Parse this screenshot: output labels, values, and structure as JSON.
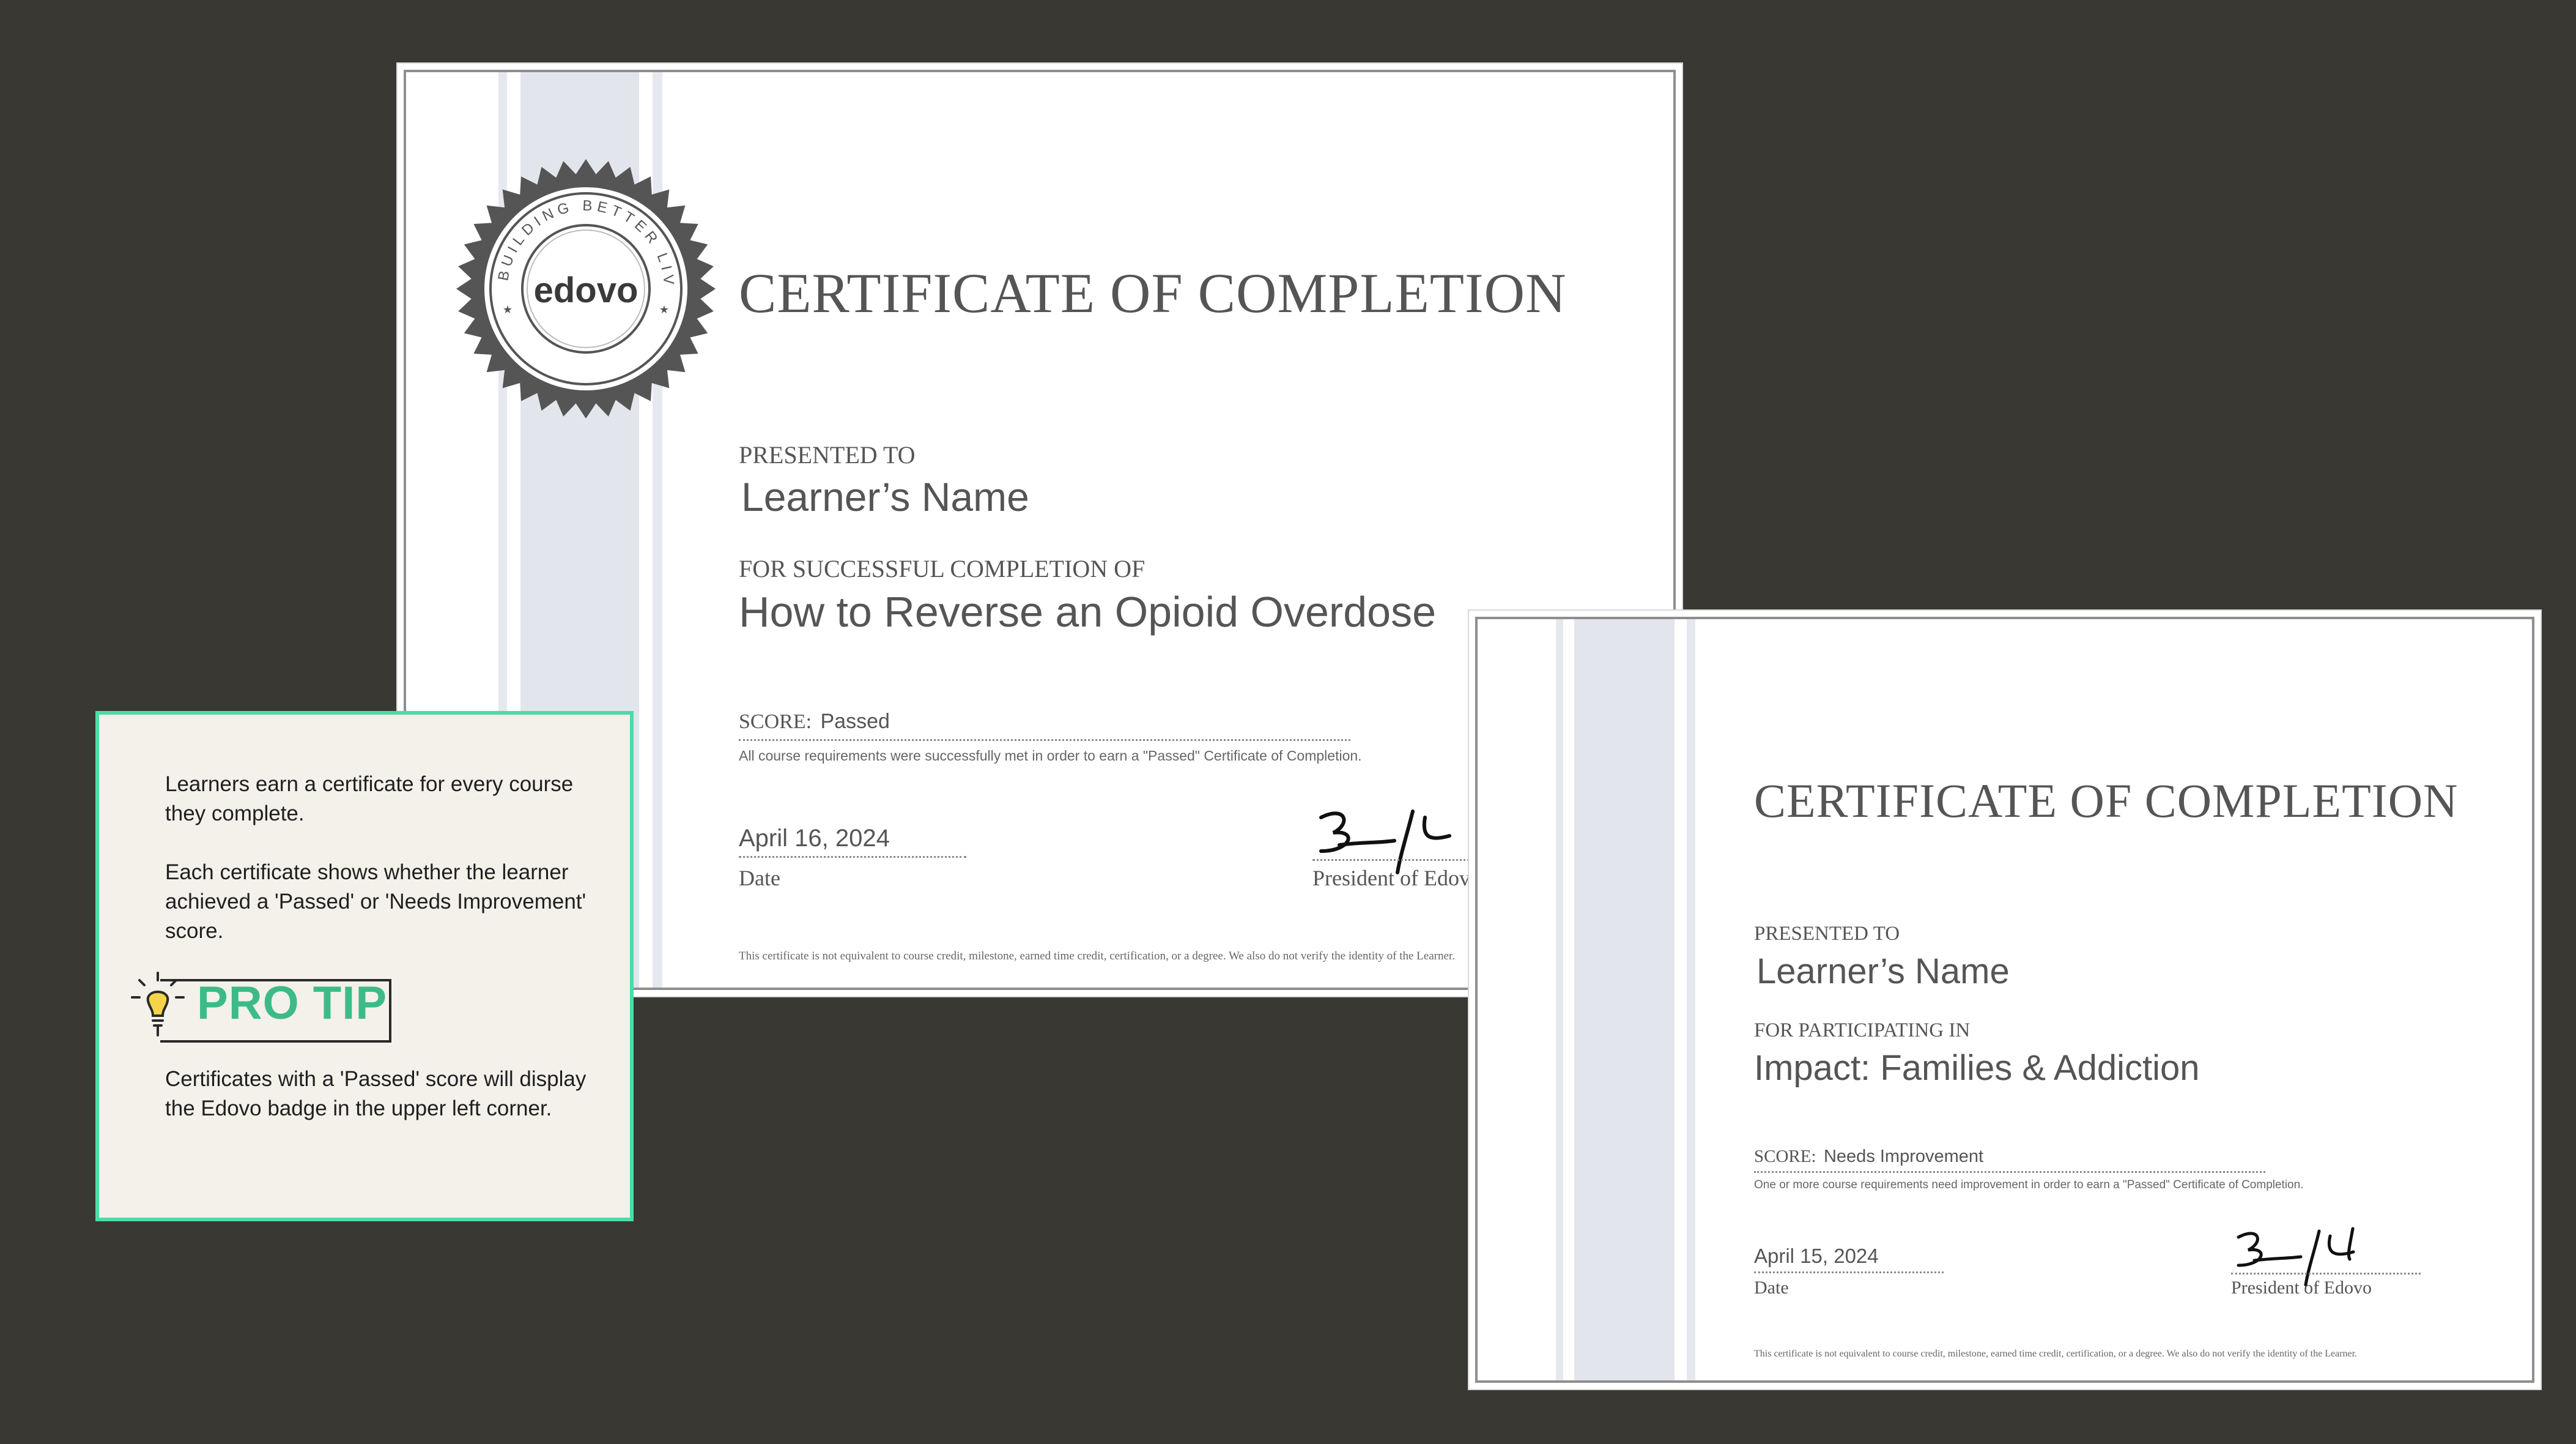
{
  "certificate_main": {
    "seal_ring_text": "BUILDING BETTER LIVES",
    "seal_logo": "edovo",
    "title": "CERTIFICATE OF COMPLETION",
    "presented_label": "PRESENTED TO",
    "learner_name": "Learner’s Name",
    "for_label": "FOR SUCCESSFUL COMPLETION OF",
    "course": "How to Reverse an Opioid Overdose",
    "score_label": "SCORE:",
    "score_value": "Passed",
    "score_note": "All course requirements were successfully met in order to earn a \"Passed\" Certificate of Completion.",
    "date_value": "April 16, 2024",
    "date_label": "Date",
    "signer_label": "President of Edovo",
    "disclaimer": "This certificate is not equivalent to course credit, milestone, earned time credit, certification, or a degree. We also do not verify the identity of the Learner."
  },
  "certificate_second": {
    "title": "CERTIFICATE OF COMPLETION",
    "presented_label": "PRESENTED TO",
    "learner_name": "Learner’s Name",
    "for_label": "FOR PARTICIPATING IN",
    "course": "Impact: Families & Addiction",
    "score_label": "SCORE:",
    "score_value": "Needs Improvement",
    "score_note": "One or more course requirements need improvement in order to earn a \"Passed\" Certificate of Completion.",
    "date_value": "April 15, 2024",
    "date_label": "Date",
    "signer_label": "President of Edovo",
    "disclaimer": "This certificate is not equivalent to course credit, milestone, earned time credit, certification, or a degree. We also do not verify the identity of the Learner."
  },
  "tip": {
    "paragraph_1": "Learners earn a certificate for every course they complete.",
    "paragraph_2": "Each certificate shows whether the learner achieved a 'Passed' or 'Needs Improvement' score.",
    "pro_tip_label": "PRO TIP",
    "paragraph_3": "Certificates with a 'Passed' score will display the Edovo badge in the upper left corner.",
    "icon": "lightbulb-icon"
  },
  "colors": {
    "background": "#393833",
    "tip_border": "#4ddba7",
    "tip_background": "#f3f1ea",
    "pro_tip_text": "#3dbb86",
    "seal": "#555555"
  }
}
